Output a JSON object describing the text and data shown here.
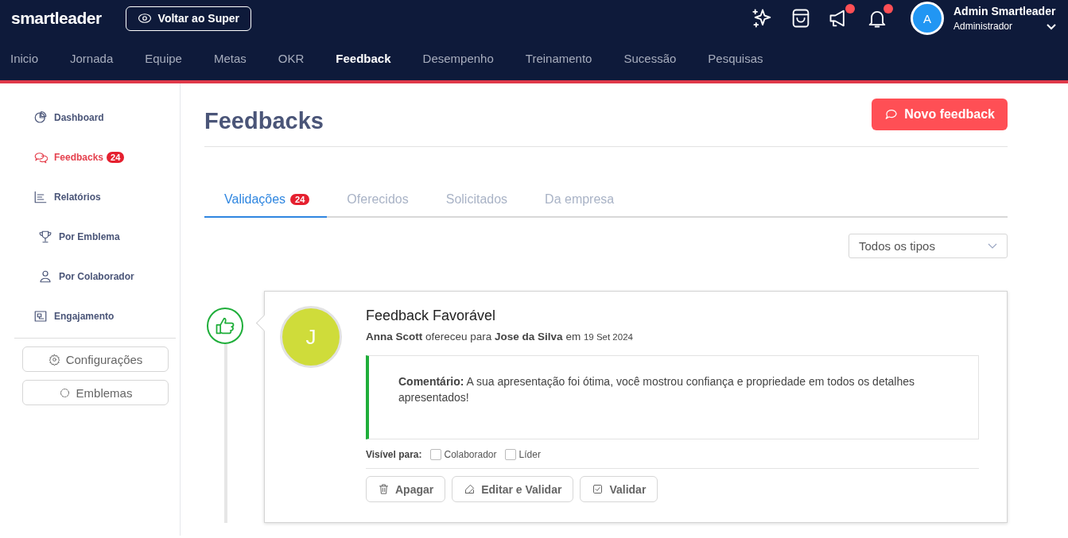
{
  "brand": "smartleader",
  "back_button": {
    "label": "Voltar ao Super"
  },
  "header_icons": [
    {
      "kind": "sparkles",
      "notification": false
    },
    {
      "kind": "bag",
      "notification": false
    },
    {
      "kind": "megaphone",
      "notification": true
    },
    {
      "kind": "bell",
      "notification": true
    }
  ],
  "user": {
    "initial": "A",
    "name": "Admin Smartleader",
    "role": "Administrador"
  },
  "nav": [
    {
      "label": "Inicio",
      "selected": false
    },
    {
      "label": "Jornada",
      "selected": false
    },
    {
      "label": "Equipe",
      "selected": false
    },
    {
      "label": "Metas",
      "selected": false
    },
    {
      "label": "OKR",
      "selected": false
    },
    {
      "label": "Feedback",
      "selected": true
    },
    {
      "label": "Desempenho",
      "selected": false
    },
    {
      "label": "Treinamento",
      "selected": false
    },
    {
      "label": "Sucessão",
      "selected": false
    },
    {
      "label": "Pesquisas",
      "selected": false
    }
  ],
  "sidebar": {
    "items": [
      {
        "kind": "dashboard",
        "label": "Dashboard",
        "selected": false
      },
      {
        "kind": "feedbacks",
        "label": "Feedbacks",
        "badge": "24",
        "selected": true
      },
      {
        "kind": "reports",
        "label": "Relatórios",
        "selected": false
      },
      {
        "kind": "trophy",
        "label": "Por Emblema",
        "selected": false
      },
      {
        "kind": "person",
        "label": "Por Colaborador",
        "selected": false
      },
      {
        "kind": "engagement",
        "label": "Engajamento",
        "selected": false
      }
    ],
    "buttons": [
      {
        "kind": "gear",
        "label": "Configurações"
      },
      {
        "kind": "emblem",
        "label": "Emblemas"
      }
    ]
  },
  "page": {
    "title": "Feedbacks",
    "new_button": "Novo feedback"
  },
  "tabs": [
    {
      "label": "Validações",
      "badge": "24",
      "selected": true
    },
    {
      "label": "Oferecidos",
      "selected": false
    },
    {
      "label": "Solicitados",
      "selected": false
    },
    {
      "label": "Da empresa",
      "selected": false
    }
  ],
  "filter": {
    "value": "Todos os tipos"
  },
  "feedback": {
    "kind": "positive",
    "initial": "J",
    "title": "Feedback Favorável",
    "byline": "**Anna Scott** ofereceu para **Jose da Silva** em",
    "date": "19 Set 2024",
    "comment": "**Comentário:** A sua apresentação foi ótima, você mostrou confiança e propriedade em todos os detalhes apresentados!",
    "visible_label": "Visível para:",
    "visible_to": [
      {
        "label": "Colaborador",
        "checked": false
      },
      {
        "label": "Líder",
        "checked": false
      }
    ],
    "actions": [
      {
        "kind": "delete",
        "label": "Apagar"
      },
      {
        "kind": "edit",
        "label": "Editar e Validar"
      },
      {
        "kind": "validate",
        "label": "Validar"
      }
    ]
  }
}
